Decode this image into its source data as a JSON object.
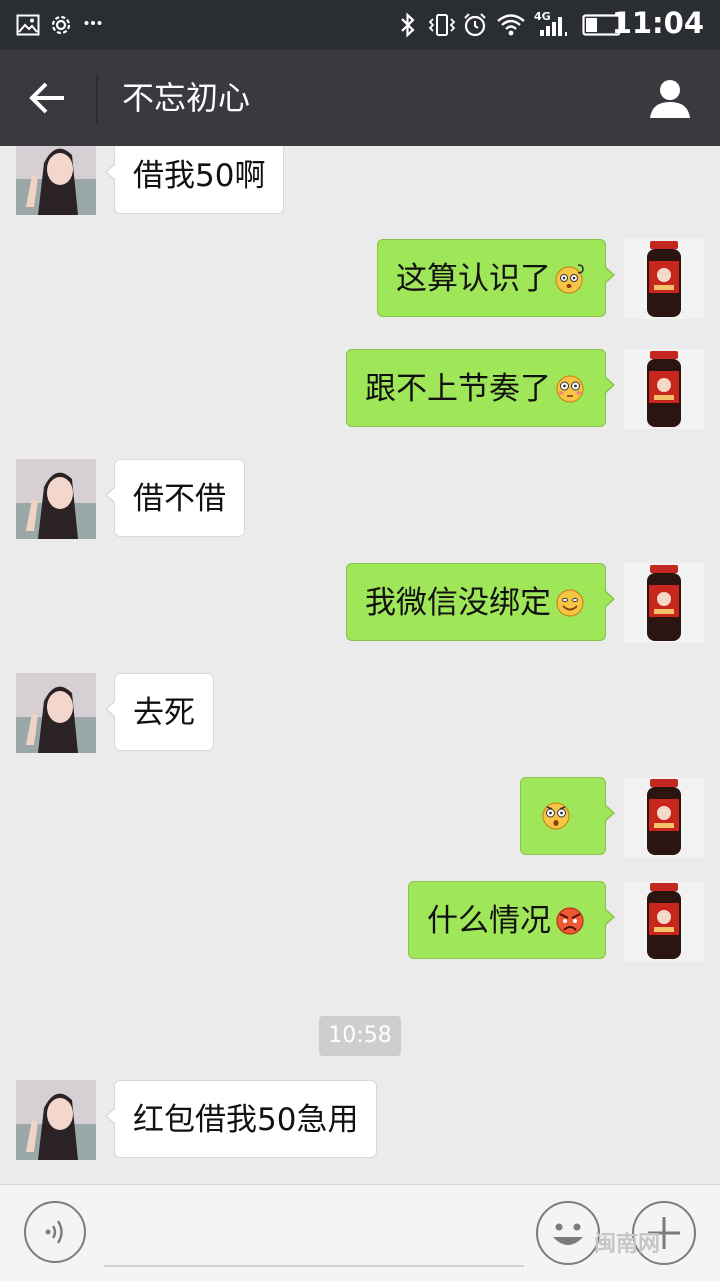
{
  "status_bar": {
    "time": "11:04",
    "network": "4G",
    "icons": [
      "image-icon",
      "settings-icon",
      "more-dots-icon",
      "bluetooth-icon",
      "vibrate-icon",
      "alarm-icon",
      "wifi-icon",
      "signal-icon",
      "battery-icon"
    ]
  },
  "title_bar": {
    "title": "不忘初心",
    "back_icon": "arrow-left-icon",
    "contact_icon": "person-icon"
  },
  "messages": [
    {
      "side": "in",
      "text": "借我50啊",
      "emoji": ""
    },
    {
      "side": "out",
      "text": "这算认识了",
      "emoji": "dizzy-face-emoji"
    },
    {
      "side": "out",
      "text": "跟不上节奏了",
      "emoji": "flushed-face-emoji"
    },
    {
      "side": "in",
      "text": "借不借",
      "emoji": ""
    },
    {
      "side": "out",
      "text": "我微信没绑定",
      "emoji": "smile-face-emoji"
    },
    {
      "side": "in",
      "text": "去死",
      "emoji": ""
    },
    {
      "side": "out",
      "text": "",
      "emoji": "surprised-face-emoji"
    },
    {
      "side": "out",
      "text": "什么情况",
      "emoji": "angry-face-emoji"
    },
    {
      "side": "in",
      "text": "红包借我50急用",
      "emoji": ""
    }
  ],
  "timestamp": "10:58",
  "input_bar": {
    "voice_icon": "voice-wave-icon",
    "emoji_icon": "smiley-icon",
    "plus_icon": "plus-icon",
    "input_value": ""
  },
  "watermark": "闽南网",
  "colors": {
    "status_bar_bg": "#2a2d31",
    "title_bar_bg": "#393a3f",
    "chat_bg": "#ebebeb",
    "outgoing_bubble": "#9fe658",
    "incoming_bubble": "#ffffff"
  }
}
